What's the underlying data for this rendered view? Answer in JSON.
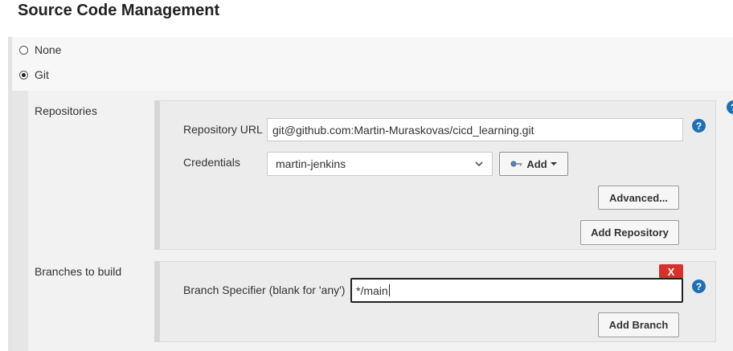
{
  "section": {
    "title": "Source Code Management"
  },
  "scm_options": [
    {
      "label": "None",
      "checked": false
    },
    {
      "label": "Git",
      "checked": true
    }
  ],
  "repositories": {
    "label": "Repositories",
    "url_label": "Repository URL",
    "url_value": "git@github.com:Martin-Muraskovas/cicd_learning.git",
    "credentials_label": "Credentials",
    "credentials_value": "martin-jenkins",
    "add_label": "Add",
    "advanced_label": "Advanced...",
    "add_repository_label": "Add Repository"
  },
  "branches": {
    "label": "Branches to build",
    "delete_label": "X",
    "specifier_label": "Branch Specifier (blank for 'any')",
    "specifier_value": "*/main",
    "add_branch_label": "Add Branch"
  },
  "help": {
    "glyph": "?"
  },
  "colors": {
    "help_blue": "#1f6fb5",
    "delete_red": "#d6322b"
  }
}
